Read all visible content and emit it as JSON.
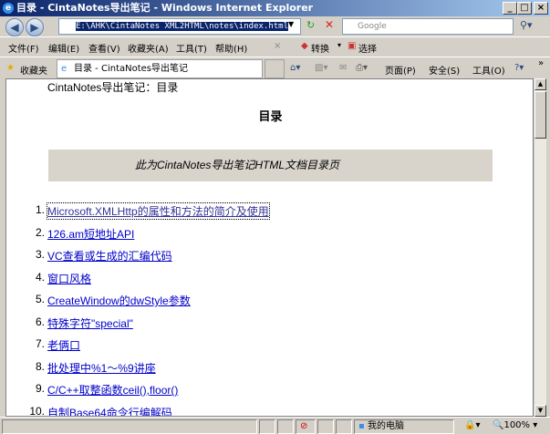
{
  "window": {
    "title": "目录 - CintaNotes导出笔记 - Windows Internet Explorer"
  },
  "address": {
    "url": "E:\\AHK\\CintaNotes XML2HTML\\notes\\index.html",
    "search_placeholder": "Google"
  },
  "menu": [
    "文件(F)",
    "编辑(E)",
    "查看(V)",
    "收藏夹(A)",
    "工具(T)",
    "帮助(H)"
  ],
  "toolbar": {
    "convert": "转换",
    "select": "选择"
  },
  "favorites_label": "收藏夹",
  "tab": {
    "title": "目录 - CintaNotes导出笔记"
  },
  "command": {
    "page": "页面(P)",
    "safety": "安全(S)",
    "tools": "工具(O)"
  },
  "page": {
    "header": "CintaNotes导出笔记：目录",
    "title": "目录",
    "description": "此为CintaNotes导出笔记HTML文档目录页",
    "items": [
      {
        "num": "1.",
        "label": "Microsoft.XMLHttp的属性和方法的简介及使用"
      },
      {
        "num": "2.",
        "label": "126.am短地址API"
      },
      {
        "num": "3.",
        "label": "VC查看或生成的汇编代码"
      },
      {
        "num": "4.",
        "label": "窗口风格"
      },
      {
        "num": "5.",
        "label": "CreateWindow的dwStyle参数"
      },
      {
        "num": "6.",
        "label": "特殊字符\"special\""
      },
      {
        "num": "7.",
        "label": "老俩口"
      },
      {
        "num": "8.",
        "label": "批处理中%1～%9讲座"
      },
      {
        "num": "9.",
        "label": "C/C++取整函数ceil(),floor()"
      },
      {
        "num": "10.",
        "label": "自制Base64命令行编解码"
      }
    ]
  },
  "status": {
    "zone": "我的电脑",
    "zoom": "100%"
  }
}
